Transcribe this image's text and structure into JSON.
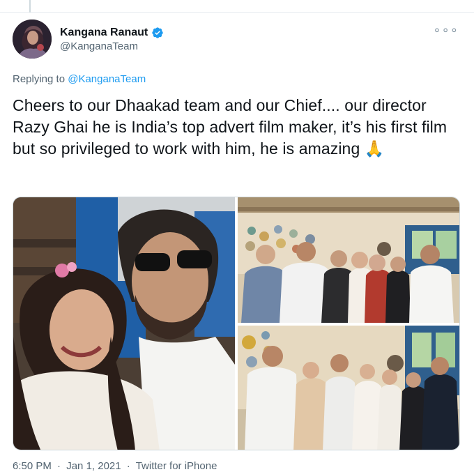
{
  "tweet": {
    "author": {
      "display_name": "Kangana Ranaut",
      "handle": "@KanganaTeam",
      "verified": true,
      "avatar_icon": "profile-photo"
    },
    "more_icon": "ellipsis-icon",
    "reply": {
      "prefix": "Replying to",
      "mention": "@KanganaTeam"
    },
    "text": "Cheers to our Dhaakad team and our Chief.... our director Razy Ghai he is India’s top advert film maker, it’s his first film but so privileged to work with him, he is amazing 🙏",
    "media": [
      {
        "kind": "photo",
        "subject": "selfie-couple"
      },
      {
        "kind": "photo",
        "subject": "team-group-1"
      },
      {
        "kind": "photo",
        "subject": "team-group-2"
      }
    ],
    "meta": {
      "time": "6:50 PM",
      "separator": "·",
      "date": "Jan 1, 2021",
      "source": "Twitter for iPhone"
    }
  },
  "colors": {
    "text": "#0f1419",
    "secondary": "#536471",
    "link": "#1d9bf0",
    "verified": "#1d9bf0",
    "border": "#cfd9de"
  }
}
